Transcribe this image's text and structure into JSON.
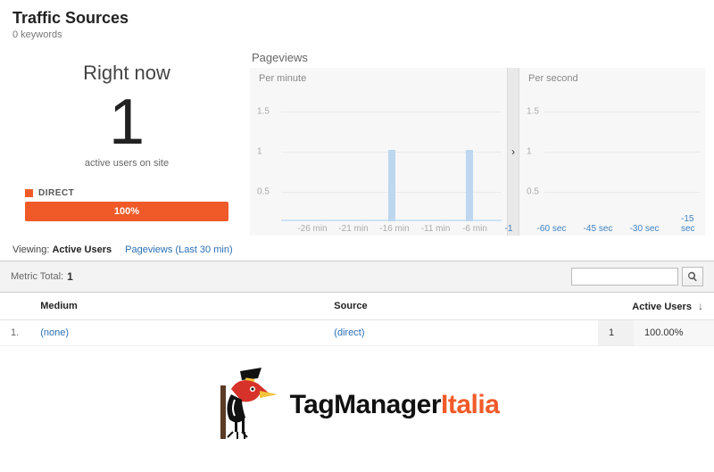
{
  "header": {
    "title": "Traffic Sources",
    "subtitle": "0 keywords"
  },
  "rightnow": {
    "label": "Right now",
    "value": "1",
    "caption": "active users on site",
    "legend_label": "DIRECT",
    "bar_label": "100%"
  },
  "pageviews": {
    "title": "Pageviews",
    "per_minute": {
      "label": "Per minute"
    },
    "per_second": {
      "label": "Per second"
    }
  },
  "tabs": {
    "viewing_label": "Viewing:",
    "active_users": "Active Users",
    "pageviews_30": "Pageviews (Last 30 min)"
  },
  "metric_bar": {
    "label": "Metric Total:",
    "value": "1"
  },
  "table": {
    "headers": {
      "medium": "Medium",
      "source": "Source",
      "active_users": "Active Users"
    },
    "rows": [
      {
        "idx": "1.",
        "medium": "(none)",
        "source": "(direct)",
        "count": "1",
        "pct": "100.00%"
      }
    ]
  },
  "logo": {
    "brand1": "TagManager",
    "brand2": "Italia"
  },
  "chart_data": [
    {
      "type": "bar",
      "title": "Pageviews — Per minute",
      "xlabel": "min",
      "ylabel": "",
      "ylim": [
        0,
        2
      ],
      "y_ticks": [
        0.5,
        1.0,
        1.5
      ],
      "x_ticks": [
        "-26 min",
        "-21 min",
        "-16 min",
        "-11 min",
        "-6 min",
        "-1"
      ],
      "categories": [
        "-30",
        "-29",
        "-28",
        "-27",
        "-26",
        "-25",
        "-24",
        "-23",
        "-22",
        "-21",
        "-20",
        "-19",
        "-18",
        "-17",
        "-16",
        "-15",
        "-14",
        "-13",
        "-12",
        "-11",
        "-10",
        "-9",
        "-8",
        "-7",
        "-6",
        "-5",
        "-4",
        "-3",
        "-2",
        "-1"
      ],
      "values": [
        0,
        0,
        0,
        0,
        0,
        0,
        0,
        0,
        0,
        0,
        0,
        0,
        0,
        0,
        1,
        0,
        0,
        0,
        0,
        0,
        0,
        0,
        0,
        0,
        1,
        0,
        0,
        0,
        0,
        0
      ]
    },
    {
      "type": "bar",
      "title": "Pageviews — Per second",
      "xlabel": "sec",
      "ylabel": "",
      "ylim": [
        0,
        2
      ],
      "y_ticks": [
        0.5,
        1.0,
        1.5
      ],
      "x_ticks": [
        "-60 sec",
        "-45 sec",
        "-30 sec",
        "-15 sec"
      ],
      "categories": [
        "-60",
        "-45",
        "-30",
        "-15"
      ],
      "values": [
        0,
        0,
        0,
        0
      ]
    }
  ]
}
